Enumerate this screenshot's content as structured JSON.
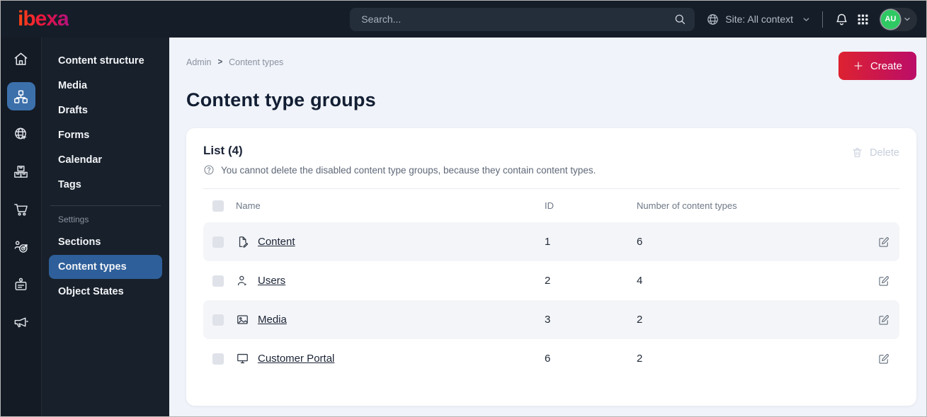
{
  "topbar": {
    "logo": "ibexa",
    "search_placeholder": "Search...",
    "site_context_label": "Site: All context",
    "avatar_initials": "AU"
  },
  "sidebar": {
    "items": [
      "Content structure",
      "Media",
      "Drafts",
      "Forms",
      "Calendar",
      "Tags"
    ],
    "settings_label": "Settings",
    "settings_items": [
      "Sections",
      "Content types",
      "Object States"
    ],
    "active_item": "Content types"
  },
  "page": {
    "breadcrumb": {
      "root": "Admin",
      "separator": ">",
      "current": "Content types"
    },
    "title": "Content type groups",
    "create_button": "Create"
  },
  "list_card": {
    "title": "List (4)",
    "info_text": "You cannot delete the disabled content type groups, because they contain content types.",
    "delete_button": "Delete",
    "columns": {
      "name": "Name",
      "id": "ID",
      "count": "Number of content types"
    },
    "rows": [
      {
        "name": "Content",
        "id": "1",
        "count": "6",
        "icon": "file-edit-icon"
      },
      {
        "name": "Users",
        "id": "2",
        "count": "4",
        "icon": "user-icon"
      },
      {
        "name": "Media",
        "id": "3",
        "count": "2",
        "icon": "image-icon"
      },
      {
        "name": "Customer Portal",
        "id": "6",
        "count": "2",
        "icon": "monitor-icon"
      }
    ]
  },
  "colors": {
    "topbar_bg": "#151d28",
    "rail_bg": "#141b25",
    "menu_bg": "#18202b",
    "active_blue": "#2e5f9a",
    "rail_active_blue": "#3c70ab",
    "create_gradient_start": "#dd2231",
    "create_gradient_end": "#bb0d68",
    "content_bg": "#f0f3f9",
    "avatar_green": "#2fc963",
    "row_alt_bg": "#f4f5f8"
  }
}
